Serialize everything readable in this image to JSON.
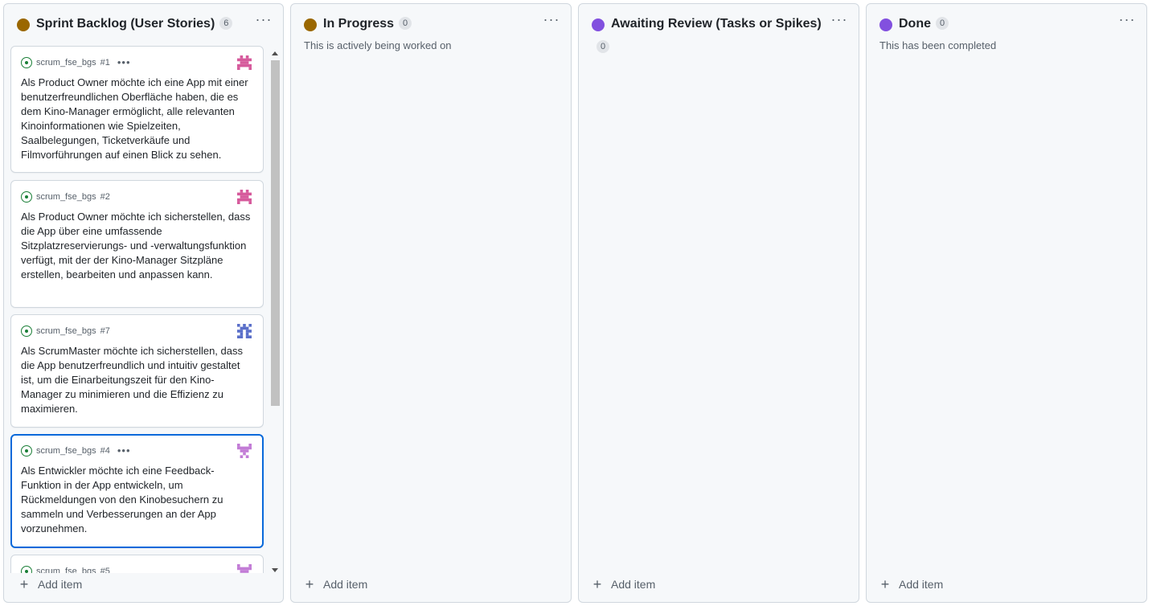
{
  "columns": [
    {
      "title": "Sprint Backlog (User Stories)",
      "count": "6",
      "dot_color": "#9a6700",
      "description": "",
      "add_label": "Add item",
      "cards": [
        {
          "repo": "scrum_fse_bgs",
          "number": "#1",
          "title": "Als Product Owner möchte ich eine App mit einer benutzerfreundlichen Oberfläche haben, die es dem Kino-Manager ermöglicht, alle relevanten Kinoinformationen wie Spielzeiten, Saalbelegungen, Ticketverkäufe und Filmvorführungen auf einen Blick zu sehen.",
          "show_menu": true,
          "avatar_color": "#d65a9c",
          "selected": false
        },
        {
          "repo": "scrum_fse_bgs",
          "number": "#2",
          "title": "Als Product Owner möchte ich sicherstellen, dass die App über eine umfassende Sitzplatzreservierungs- und -verwaltungsfunktion verfügt, mit der der Kino-Manager Sitzpläne erstellen, bearbeiten und anpassen kann.",
          "show_menu": false,
          "avatar_color": "#d65a9c",
          "selected": false
        },
        {
          "repo": "scrum_fse_bgs",
          "number": "#7",
          "title": "Als ScrumMaster möchte ich sicherstellen, dass die App benutzerfreundlich und intuitiv gestaltet ist, um die Einarbeitungszeit für den Kino-Manager zu minimieren und die Effizienz zu maximieren.",
          "show_menu": false,
          "avatar_color": "#5a6fc9",
          "selected": false
        },
        {
          "repo": "scrum_fse_bgs",
          "number": "#4",
          "title": "Als Entwickler möchte ich eine Feedback-Funktion in der App entwickeln, um Rückmeldungen von den Kinobesuchern zu sammeln und Verbesserungen an der App vorzunehmen.",
          "show_menu": true,
          "avatar_color": "#c27cd6",
          "selected": true
        },
        {
          "repo": "scrum_fse_bgs",
          "number": "#5",
          "title": "",
          "show_menu": false,
          "avatar_color": "#c27cd6",
          "selected": false
        }
      ]
    },
    {
      "title": "In Progress",
      "count": "0",
      "dot_color": "#9a6700",
      "description": "This is actively being worked on",
      "add_label": "Add item",
      "cards": []
    },
    {
      "title": "Awaiting Review (Tasks or Spikes)",
      "count": "0",
      "dot_color": "#8250df",
      "description": "",
      "add_label": "Add item",
      "cards": []
    },
    {
      "title": "Done",
      "count": "0",
      "dot_color": "#8250df",
      "description": "This has been completed",
      "add_label": "Add item",
      "cards": []
    }
  ],
  "icons": {
    "issue": "issue-opened-icon",
    "kebab": "kebab-horizontal-icon",
    "plus": "plus-icon",
    "avatar": "identicon-avatar"
  }
}
